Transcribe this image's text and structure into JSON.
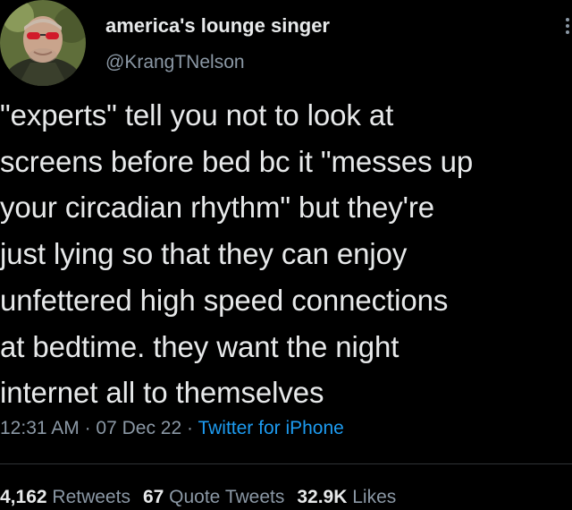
{
  "author": {
    "display_name": "america's lounge singer",
    "handle": "@KrangTNelson",
    "avatar_icon": "avatar-photo-icon"
  },
  "tweet": {
    "text": "\"experts\" tell you not to look at\nscreens before bed bc it \"messes up\nyour circadian rhythm\" but they're\njust lying so that they can enjoy\nunfettered high speed connections\nat bedtime. they want the night\ninternet all to themselves",
    "time": "12:31 AM",
    "date": "07 Dec 22",
    "separator": " · ",
    "source": "Twitter for iPhone"
  },
  "stats": {
    "retweets_count": "4,162",
    "retweets_label": "Retweets",
    "quotes_count": "67",
    "quotes_label": "Quote Tweets",
    "likes_count": "32.9K",
    "likes_label": "Likes"
  },
  "colors": {
    "background": "#000000",
    "text": "#e7e9ea",
    "secondary": "#8b98a5",
    "link": "#1d9bf0"
  }
}
